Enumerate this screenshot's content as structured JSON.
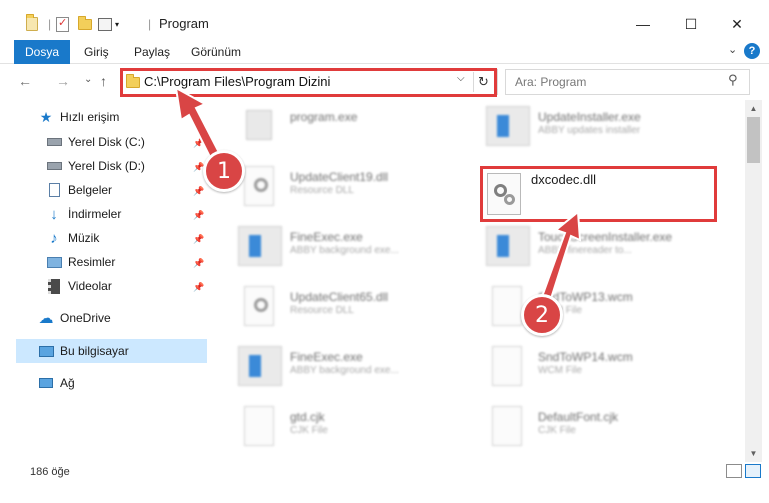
{
  "window": {
    "title": "Program",
    "minimize_glyph": "—",
    "maximize_glyph": "☐",
    "close_glyph": "✕"
  },
  "ribbon": {
    "file_tab": "Dosya",
    "tabs": [
      "Giriş",
      "Paylaş",
      "Görünüm"
    ],
    "help_glyph": "?"
  },
  "nav": {
    "back_glyph": "←",
    "forward_glyph": "→",
    "recent_glyph": "⌄",
    "up_glyph": "↑",
    "address": "C:\\Program Files\\Program Dizini",
    "search_placeholder": "Ara: Program"
  },
  "sidebar": {
    "quick_access": "Hızlı erişim",
    "items": [
      {
        "label": "Yerel Disk (C:)",
        "icon": "drive-icon",
        "pinned": true
      },
      {
        "label": "Yerel Disk (D:)",
        "icon": "drive-icon",
        "pinned": true
      },
      {
        "label": "Belgeler",
        "icon": "documents-icon",
        "pinned": true
      },
      {
        "label": "İndirmeler",
        "icon": "downloads-icon",
        "pinned": true
      },
      {
        "label": "Müzik",
        "icon": "music-icon",
        "pinned": true
      },
      {
        "label": "Resimler",
        "icon": "pictures-icon",
        "pinned": true
      },
      {
        "label": "Videolar",
        "icon": "videos-icon",
        "pinned": true
      }
    ],
    "onedrive": "OneDrive",
    "this_pc": "Bu bilgisayar",
    "network": "Ağ"
  },
  "files": [
    {
      "name": "program.exe",
      "sub": "",
      "type": "exe"
    },
    {
      "name": "UpdateInstaller.exe",
      "sub": "ABBY updates installer",
      "type": "exe"
    },
    {
      "name": "UpdateClient19.dll",
      "sub": "Resource DLL",
      "type": "dll"
    },
    {
      "name": "dxcodec.dll",
      "sub": "",
      "type": "dll",
      "highlighted": true
    },
    {
      "name": "FineExec.exe",
      "sub": "ABBY background exe...",
      "type": "exe"
    },
    {
      "name": "TouchScreenInstaller.exe",
      "sub": "ABBY finereader to...",
      "type": "exe"
    },
    {
      "name": "UpdateClient65.dll",
      "sub": "Resource DLL",
      "type": "dll"
    },
    {
      "name": "SndToWP13.wcm",
      "sub": "WCM File",
      "type": "file"
    },
    {
      "name": "FineExec.exe",
      "sub": "ABBY background exe...",
      "type": "exe"
    },
    {
      "name": "SndToWP14.wcm",
      "sub": "WCM File",
      "type": "file"
    },
    {
      "name": "gtd.cjk",
      "sub": "CJK File",
      "type": "file"
    },
    {
      "name": "DefaultFont.cjk",
      "sub": "CJK File",
      "type": "file"
    }
  ],
  "status": {
    "item_count": "186 öğe"
  },
  "annotations": {
    "step1": "1",
    "step2": "2",
    "color": "#d94545"
  }
}
